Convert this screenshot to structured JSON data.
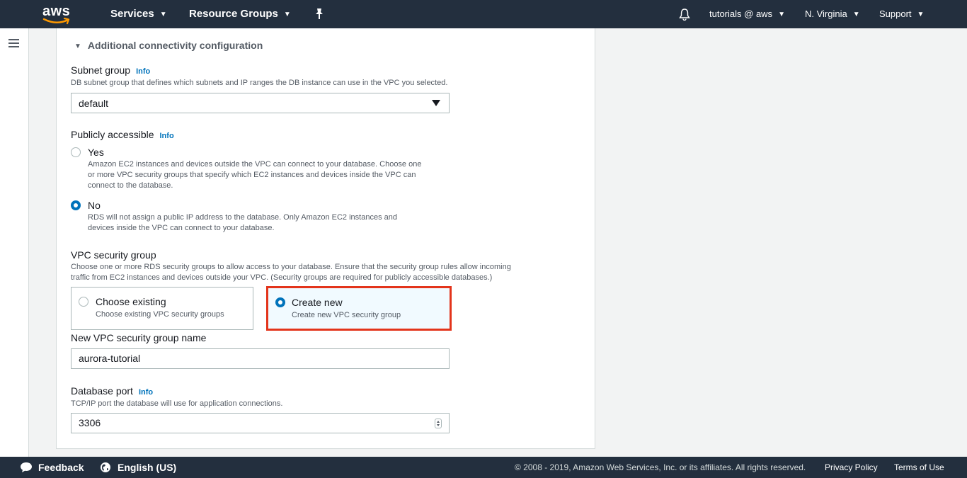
{
  "topnav": {
    "logo_text": "aws",
    "services": "Services",
    "resource_groups": "Resource Groups",
    "account": "tutorials @ aws",
    "region": "N. Virginia",
    "support": "Support"
  },
  "section": {
    "title": "Additional connectivity configuration"
  },
  "subnet_group": {
    "label": "Subnet group",
    "info": "Info",
    "description": "DB subnet group that defines which subnets and IP ranges the DB instance can use in the VPC you selected.",
    "value": "default"
  },
  "publicly_accessible": {
    "label": "Publicly accessible",
    "info": "Info",
    "yes_label": "Yes",
    "yes_desc_1": "Amazon EC2 instances and devices outside the VPC can connect to your database. Choose one",
    "yes_desc_2": "or more VPC security groups that specify which EC2 instances and devices inside the VPC can",
    "yes_desc_3": "connect to the database.",
    "no_label": "No",
    "no_desc_1": "RDS will not assign a public IP address to the database. Only Amazon EC2 instances and",
    "no_desc_2": "devices inside the VPC can connect to your database.",
    "selected": "No"
  },
  "vpc_security_group": {
    "label": "VPC security group",
    "description_1": "Choose one or more RDS security groups to allow access to your database. Ensure that the security group rules allow incoming",
    "description_2": "traffic from EC2 instances and devices outside your VPC. (Security groups are required for publicly accessible databases.)",
    "existing_title": "Choose existing",
    "existing_desc": "Choose existing VPC security groups",
    "new_title": "Create new",
    "new_desc": "Create new VPC security group",
    "selected": "Create new",
    "highlight_color": "#e3341b"
  },
  "new_sg_name": {
    "label": "New VPC security group name",
    "value": "aurora-tutorial"
  },
  "database_port": {
    "label": "Database port",
    "info": "Info",
    "description": "TCP/IP port the database will use for application connections.",
    "value": "3306"
  },
  "footer": {
    "feedback": "Feedback",
    "language": "English (US)",
    "copyright": "© 2008 - 2019, Amazon Web Services, Inc. or its affiliates. All rights reserved.",
    "privacy": "Privacy Policy",
    "terms": "Terms of Use"
  },
  "colors": {
    "nav_bg": "#232f3e",
    "link": "#0073bb",
    "selected_radio": "#0073bb"
  }
}
